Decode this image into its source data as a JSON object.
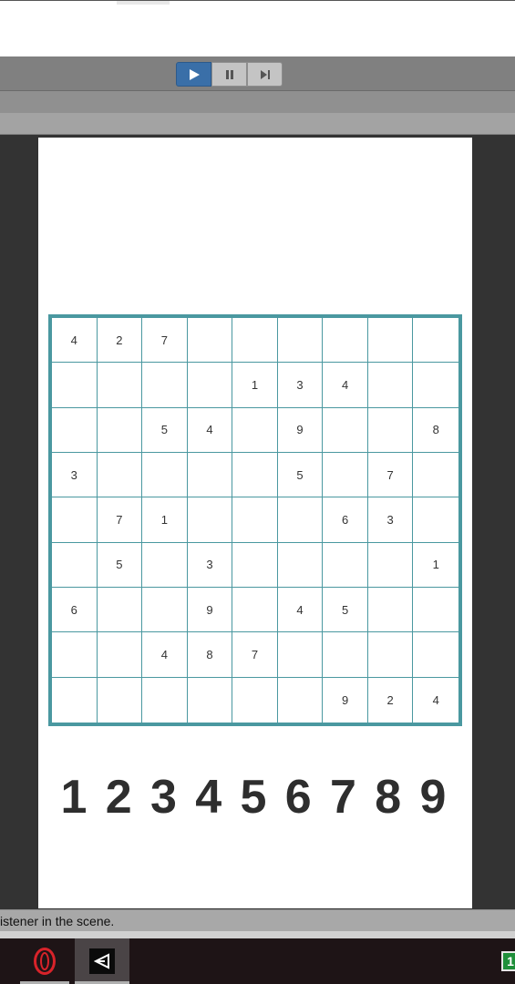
{
  "editor": {
    "play_controls": [
      {
        "name": "play-button",
        "icon": "play-icon",
        "active": true
      },
      {
        "name": "pause-button",
        "icon": "pause-icon",
        "active": false
      },
      {
        "name": "step-button",
        "icon": "step-forward-icon",
        "active": false
      }
    ],
    "accent_color": "#3a6fa8"
  },
  "game": {
    "board_color": "#4a98a0",
    "board": [
      [
        "4",
        "2",
        "7",
        "",
        "",
        "",
        "",
        "",
        ""
      ],
      [
        "",
        "",
        "",
        "",
        "1",
        "3",
        "4",
        "",
        ""
      ],
      [
        "",
        "",
        "5",
        "4",
        "",
        "9",
        "",
        "",
        "8"
      ],
      [
        "3",
        "",
        "",
        "",
        "",
        "5",
        "",
        "7",
        ""
      ],
      [
        "",
        "7",
        "1",
        "",
        "",
        "",
        "6",
        "3",
        ""
      ],
      [
        "",
        "5",
        "",
        "3",
        "",
        "",
        "",
        "",
        "1"
      ],
      [
        "6",
        "",
        "",
        "9",
        "",
        "4",
        "5",
        "",
        ""
      ],
      [
        "",
        "",
        "4",
        "8",
        "7",
        "",
        "",
        "",
        ""
      ],
      [
        "",
        "",
        "",
        "",
        "",
        "",
        "9",
        "2",
        "4"
      ]
    ],
    "number_buttons": [
      "1",
      "2",
      "3",
      "4",
      "5",
      "6",
      "7",
      "8",
      "9"
    ]
  },
  "console": {
    "status_text": "istener in the scene."
  },
  "taskbar": {
    "items": [
      {
        "name": "opera-browser-icon"
      },
      {
        "name": "unity-editor-icon"
      }
    ],
    "tray_badge": "1"
  }
}
